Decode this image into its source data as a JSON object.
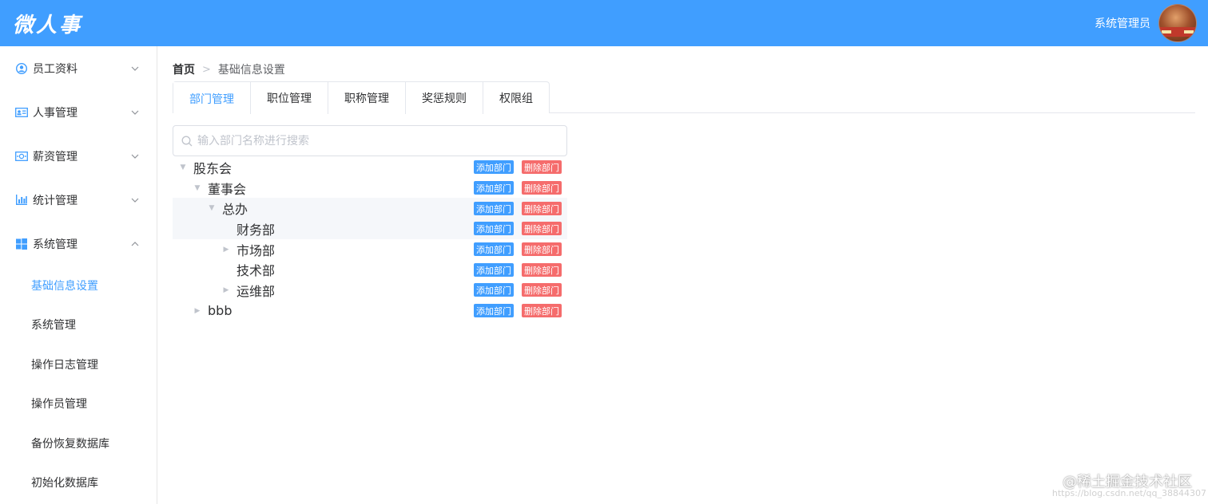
{
  "header": {
    "logo": "微人事",
    "user_name": "系统管理员"
  },
  "sidebar": {
    "items": [
      {
        "label": "员工资料",
        "icon": "user-circle-icon"
      },
      {
        "label": "人事管理",
        "icon": "id-card-icon"
      },
      {
        "label": "薪资管理",
        "icon": "money-icon"
      },
      {
        "label": "统计管理",
        "icon": "bar-chart-icon"
      },
      {
        "label": "系统管理",
        "icon": "windows-icon"
      }
    ],
    "sub_items": [
      "基础信息设置",
      "系统管理",
      "操作日志管理",
      "操作员管理",
      "备份恢复数据库",
      "初始化数据库"
    ]
  },
  "breadcrumb": {
    "home": "首页",
    "current": "基础信息设置"
  },
  "tabs": [
    "部门管理",
    "职位管理",
    "职称管理",
    "奖惩规则",
    "权限组"
  ],
  "search": {
    "placeholder": "输入部门名称进行搜索"
  },
  "tree": {
    "add_label": "添加部门",
    "delete_label": "删除部门",
    "nodes": [
      {
        "label": "股东会",
        "level": 0,
        "caret": "expanded"
      },
      {
        "label": "董事会",
        "level": 1,
        "caret": "expanded"
      },
      {
        "label": "总办",
        "level": 2,
        "caret": "expanded",
        "highlight": true
      },
      {
        "label": "财务部",
        "level": 3,
        "caret": "none",
        "highlight": true
      },
      {
        "label": "市场部",
        "level": 3,
        "caret": "collapsed"
      },
      {
        "label": "技术部",
        "level": 3,
        "caret": "none"
      },
      {
        "label": "运维部",
        "level": 3,
        "caret": "collapsed"
      },
      {
        "label": "bbb",
        "level": 1,
        "caret": "collapsed"
      }
    ]
  },
  "watermark": {
    "main": "@稀土掘金技术社区",
    "sub": "https://blog.csdn.net/qq_38844307"
  },
  "colors": {
    "primary": "#409eff",
    "danger": "#f56c6c"
  }
}
